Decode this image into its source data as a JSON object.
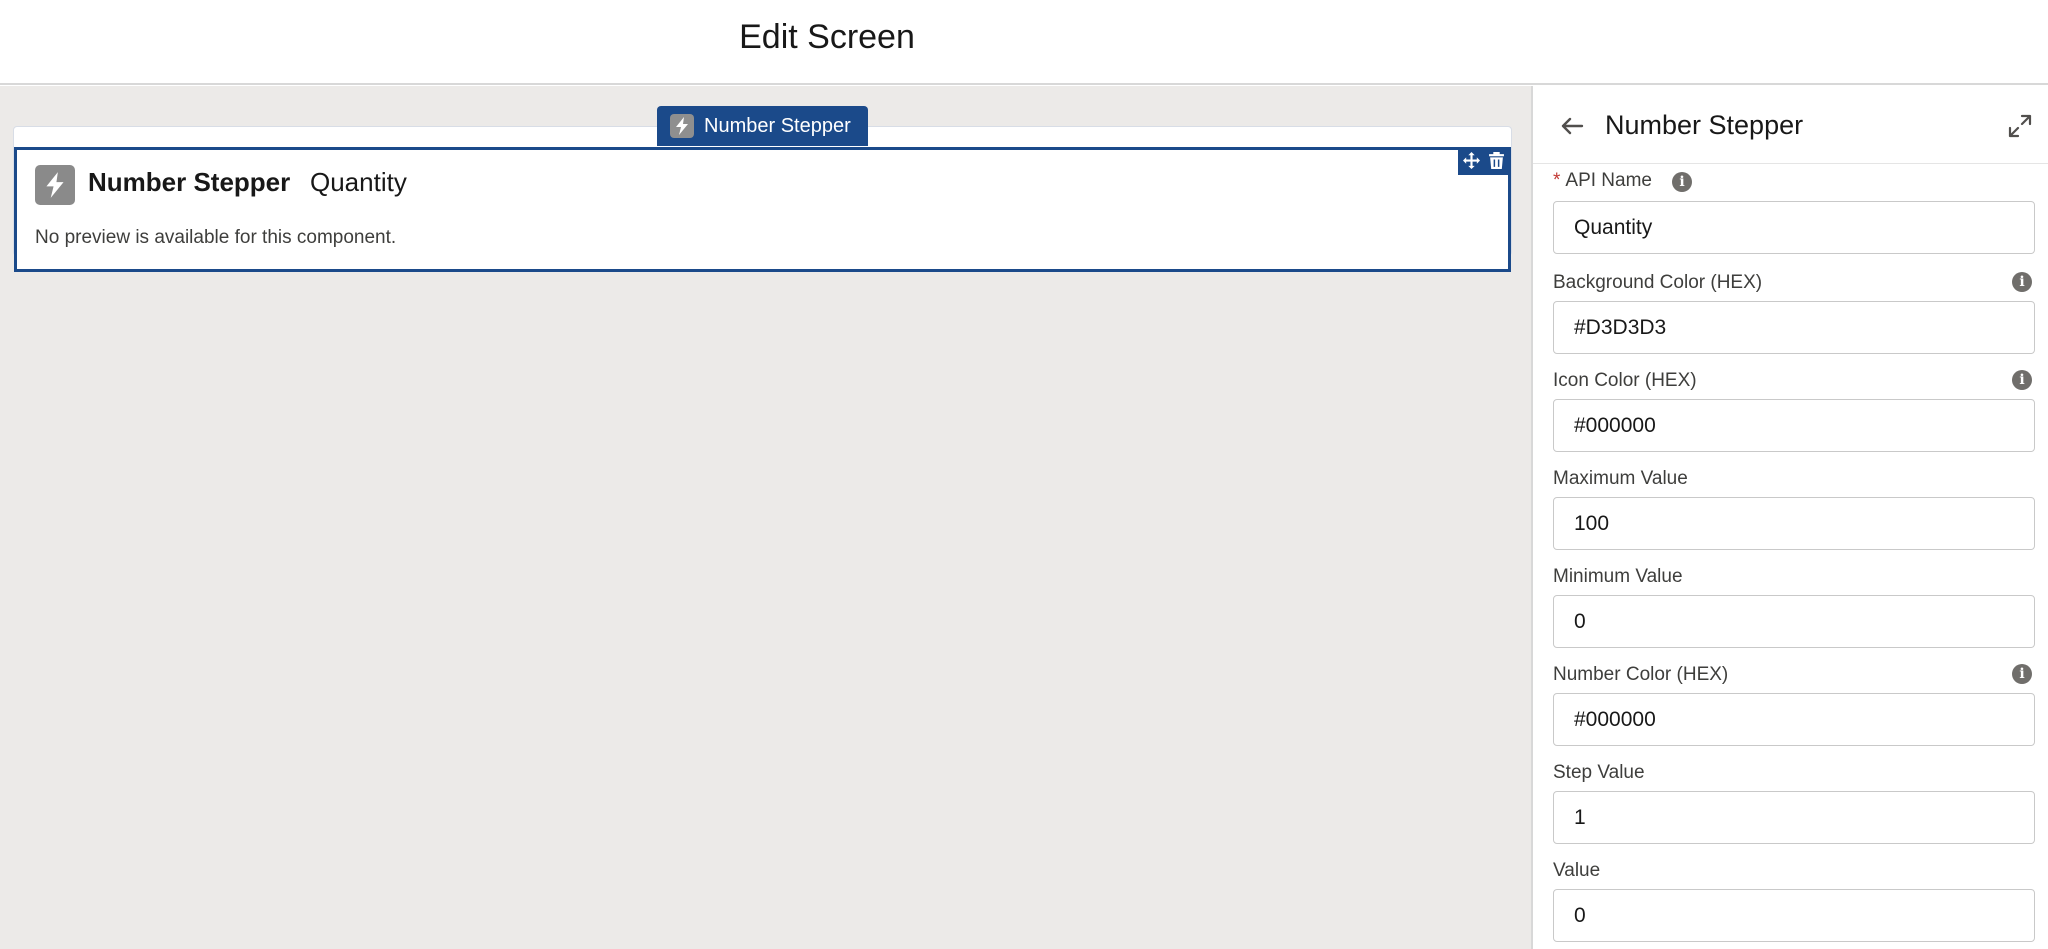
{
  "header": {
    "title": "Edit Screen"
  },
  "canvas": {
    "component_tab_label": "Number Stepper",
    "component": {
      "title": "Number Stepper",
      "subtitle": "Quantity",
      "note": "No preview is available for this component."
    }
  },
  "panel": {
    "title": "Number Stepper",
    "fields": [
      {
        "label": "API Name",
        "value": "Quantity",
        "required": true
      },
      {
        "label": "Background Color (HEX)",
        "value": "#D3D3D3"
      },
      {
        "label": "Icon Color (HEX)",
        "value": "#000000"
      },
      {
        "label": "Maximum Value",
        "value": "100"
      },
      {
        "label": "Minimum Value",
        "value": "0"
      },
      {
        "label": "Number Color (HEX)",
        "value": "#000000"
      },
      {
        "label": "Step Value",
        "value": "1"
      },
      {
        "label": "Value",
        "value": "0"
      }
    ]
  },
  "colors": {
    "accent": "#1b4a8a",
    "canvas_bg": "#eceae8",
    "required": "#c23934"
  },
  "icons": [
    "lightning-icon",
    "move-icon",
    "trash-icon",
    "back-arrow-icon",
    "expand-icon",
    "info-icon"
  ]
}
